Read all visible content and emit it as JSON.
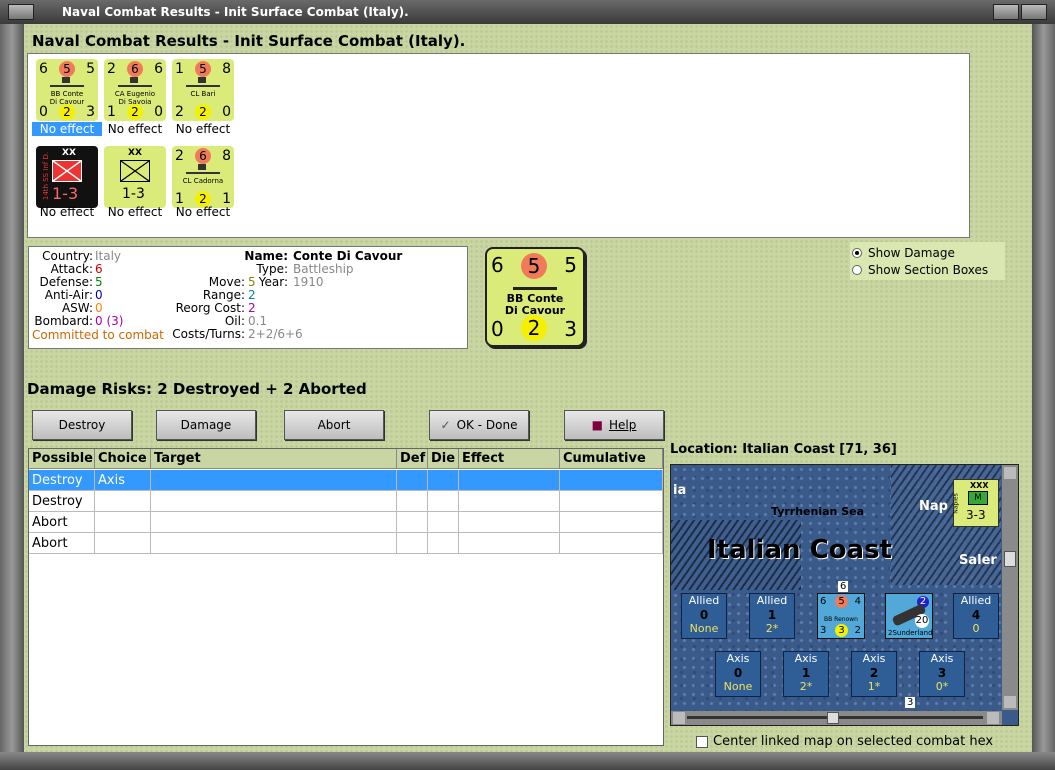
{
  "window": {
    "title": "Naval Combat Results - Init Surface Combat (Italy)."
  },
  "heading": "Naval Combat Results - Init Surface Combat (Italy).",
  "units": [
    {
      "top_left": "6",
      "top_mid": "5",
      "top_right": "5",
      "name1": "BB Conte",
      "name2": "Di Cavour",
      "bot_left": "0",
      "bot_mid": "2",
      "bot_right": "3",
      "status": "No effect",
      "selected": true,
      "kind": "ship"
    },
    {
      "top_left": "2",
      "top_mid": "6",
      "top_right": "6",
      "name1": "CA Eugenio",
      "name2": "Di Savoia",
      "bot_left": "1",
      "bot_mid": "2",
      "bot_right": "0",
      "status": "No effect",
      "selected": false,
      "kind": "ship"
    },
    {
      "top_left": "1",
      "top_mid": "5",
      "top_right": "8",
      "name1": "CL Bari",
      "name2": "",
      "bot_left": "2",
      "bot_mid": "2",
      "bot_right": "0",
      "status": "No effect",
      "selected": false,
      "kind": "ship"
    },
    {
      "top_label": "XX",
      "side_label": "14th SS Inf D.",
      "value": "1-3",
      "status": "No effect",
      "kind": "infantry-black"
    },
    {
      "top_label": "XX",
      "value": "1-3",
      "status": "No effect",
      "kind": "infantry"
    },
    {
      "top_left": "2",
      "top_mid": "6",
      "top_right": "8",
      "name1": "CL Cadorna",
      "name2": "",
      "bot_left": "1",
      "bot_mid": "2",
      "bot_right": "1",
      "status": "No effect",
      "selected": false,
      "kind": "ship"
    }
  ],
  "info": {
    "labels": {
      "country": "Country:",
      "attack": "Attack:",
      "defense": "Defense:",
      "anti_air": "Anti-Air:",
      "asw": "ASW:",
      "bombard": "Bombard:",
      "name": "Name:",
      "type": "Type:",
      "year": "Year:",
      "move": "Move:",
      "range": "Range:",
      "reorg": "Reorg Cost:",
      "oil": "Oil:",
      "costs": "Costs/Turns:"
    },
    "country": "Italy",
    "attack": "6",
    "defense": "5",
    "anti_air": "0",
    "asw": "0",
    "bombard_a": "0",
    "bombard_b": "(3)",
    "name": "Conte Di Cavour",
    "type": "Battleship",
    "year": "1910",
    "move": "5",
    "range": "2",
    "reorg": "2",
    "oil": "0.1",
    "costs": "2+2/6+6",
    "status": "Committed to combat",
    "colors": {
      "attack": "#cc0000",
      "defense": "#008800",
      "anti_air": "#0000aa",
      "asw": "#ff8800",
      "bombard": "#aa00aa",
      "move": "#888800",
      "range": "#008888",
      "reorg": "#aa00aa",
      "status": "#cc6600"
    }
  },
  "big_unit": {
    "top_left": "6",
    "top_mid": "5",
    "top_right": "5",
    "name1": "BB Conte",
    "name2": "Di Cavour",
    "bot_left": "0",
    "bot_mid": "2",
    "bot_right": "3"
  },
  "options": {
    "show_damage": "Show Damage",
    "show_sections": "Show Section Boxes"
  },
  "damage_risks": "Damage Risks:  2 Destroyed + 2 Aborted",
  "buttons": {
    "destroy": "Destroy",
    "damage": "Damage",
    "abort": "Abort",
    "ok": "OK - Done",
    "help": "Help"
  },
  "table": {
    "columns": [
      "Possible",
      "Choice",
      "Target",
      "Def",
      "Die",
      "Effect",
      "Cumulative"
    ],
    "rows": [
      {
        "possible": "Destroy",
        "choice": "Axis",
        "selected": true
      },
      {
        "possible": "Destroy",
        "choice": "",
        "selected": false
      },
      {
        "possible": "Abort",
        "choice": "",
        "selected": false
      },
      {
        "possible": "Abort",
        "choice": "",
        "selected": false
      }
    ]
  },
  "location": {
    "label": "Location:  Italian Coast [71, 36]"
  },
  "map": {
    "title": "Italian Coast",
    "sea": "Tyrrhenian Sea",
    "labels": {
      "left": "ia",
      "nap": "Nap",
      "sal": "Saler"
    },
    "counter": {
      "top": "XXX",
      "side": "Naples",
      "value": "3-3"
    },
    "allied_boxes": [
      {
        "side": "Allied",
        "num": "0",
        "val": "None"
      },
      {
        "side": "Allied",
        "num": "1",
        "val": "2*"
      },
      {
        "side": "Allied",
        "num": "4",
        "val": "0"
      }
    ],
    "axis_boxes": [
      {
        "side": "Axis",
        "num": "0",
        "val": "None"
      },
      {
        "side": "Axis",
        "num": "1",
        "val": "2*"
      },
      {
        "side": "Axis",
        "num": "2",
        "val": "1*"
      },
      {
        "side": "Axis",
        "num": "3",
        "val": "0*"
      }
    ],
    "ship": {
      "tl": "6",
      "tm": "5",
      "tr": "4",
      "name": "BB Renown",
      "bl": "3",
      "bm": "3",
      "br": "2",
      "stack": "6"
    },
    "air": {
      "name": "Sunderland",
      "a": "2",
      "b": "20",
      "c": "2"
    },
    "stack3": "3"
  },
  "center_linked": "Center linked map on selected combat hex"
}
